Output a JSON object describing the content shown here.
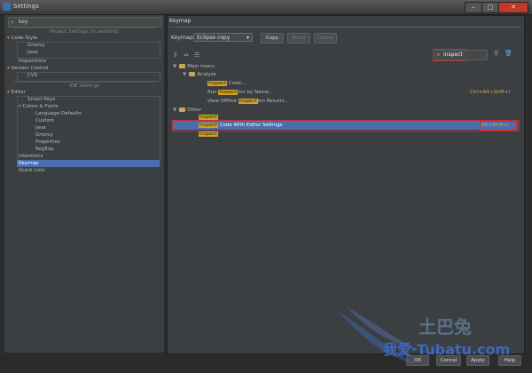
{
  "window": {
    "title": "Settings"
  },
  "search": {
    "value": "key"
  },
  "tree": {
    "project_header": "Project Settings [rc.android]",
    "code_style": "Code Style",
    "groovy": "Groovy",
    "java": "Java",
    "inspections": "Inspections",
    "version_control": "Version Control",
    "cvs": "CVS",
    "ide_header": "IDE Settings",
    "editor": "Editor",
    "smart_keys": "Smart Keys",
    "colors_fonts": "Colors & Fonts",
    "language_defaults": "Language Defaults",
    "custom": "Custom",
    "java2": "Java",
    "groovy2": "Groovy",
    "properties": "Properties",
    "regexp": "RegExp",
    "intentions": "Intentions",
    "keymap": "Keymap",
    "quick_lists": "Quick Lists"
  },
  "keymap_panel": {
    "title": "Keymap",
    "label": "Keymaps:",
    "selected": "Eclipse copy",
    "copy": "Copy",
    "reset": "Reset",
    "delete": "Delete",
    "filter": "inspect"
  },
  "rows": {
    "main_menu": "Main menu",
    "analyze": "Analyze",
    "inspect_code_hl": "Inspect",
    "inspect_code_rest": " Code...",
    "run_pre": "Run ",
    "run_hl": "Inspect",
    "run_post": "ion by Name...",
    "run_shortcut": "Ctrl+Alt+Shift+I",
    "view_pre": "View Offline ",
    "view_hl": "Inspect",
    "view_post": "ion Results...",
    "other": "Other",
    "other1": "Inspect",
    "other2_hl": "Inspect",
    "other2_rest": " Code With Editor Settings",
    "other2_shortcut": "Alt+Shift+I",
    "other3": "Inspect"
  },
  "bottom": {
    "ok": "OK",
    "cancel": "Cancel",
    "apply": "Apply",
    "help": "Help"
  },
  "watermark": {
    "text": "土巴兔",
    "url": "我爱·Tubatu.com"
  },
  "colors": {
    "accent": "#4b6eaf",
    "highlight": "#d0a227",
    "mark": "#c03030"
  }
}
